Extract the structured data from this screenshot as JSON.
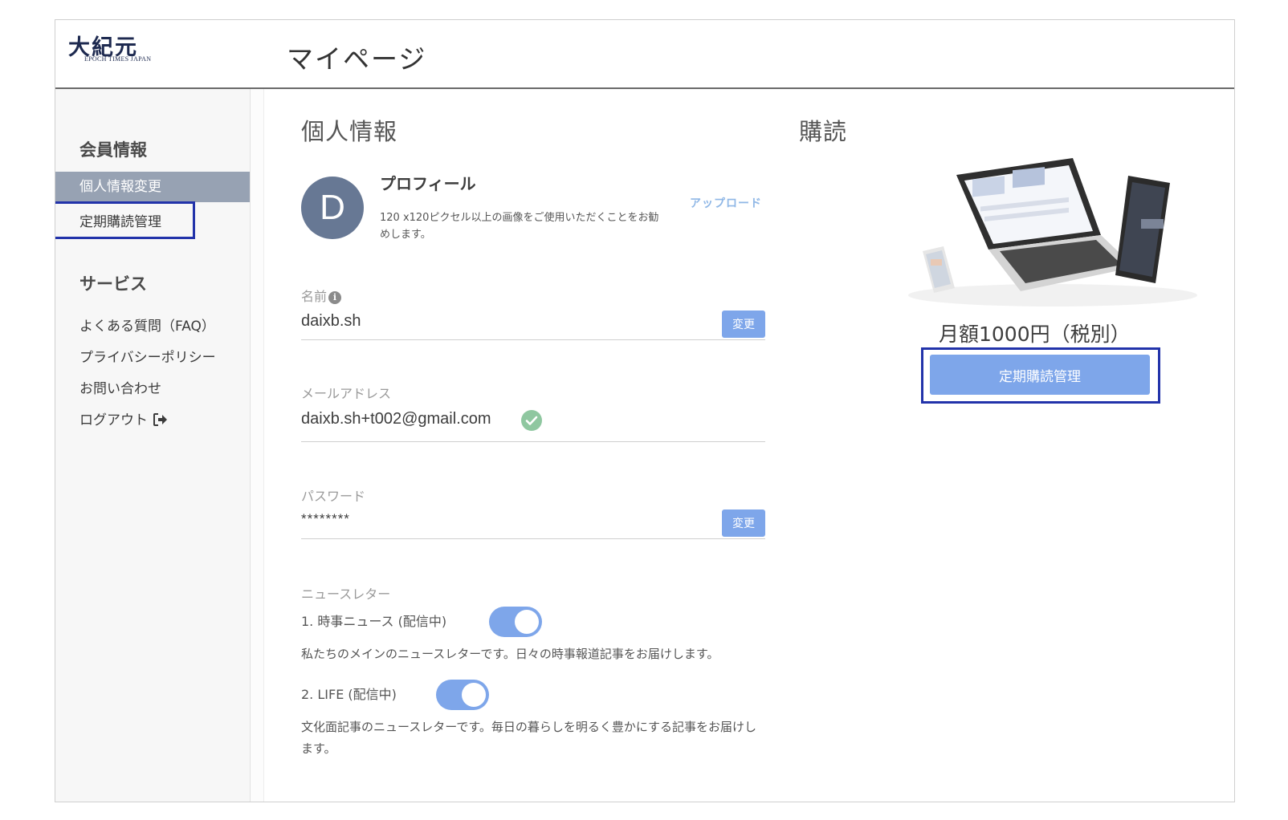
{
  "header": {
    "logo_text": "大紀元",
    "logo_sub": "EPOCH TIMES JAPAN",
    "page_title": "マイページ"
  },
  "sidebar": {
    "member_heading": "会員情報",
    "member_items": [
      "個人情報変更",
      "定期購読管理"
    ],
    "service_heading": "サービス",
    "service_items": [
      "よくある質問（FAQ）",
      "プライバシーポリシー",
      "お問い合わせ",
      "ログアウト"
    ]
  },
  "personal": {
    "title": "個人情報",
    "avatar_letter": "D",
    "profile_title": "プロフィール",
    "profile_desc": "120 x120ピクセル以上の画像をご使用いただくことをお勧めします。",
    "upload_label": "アップロード"
  },
  "fields": {
    "name_label": "名前",
    "name_value": "daixb.sh",
    "email_label": "メールアドレス",
    "email_value": "daixb.sh+t002@gmail.com",
    "password_label": "パスワード",
    "password_value": "********",
    "change_label": "変更"
  },
  "newsletter": {
    "title": "ニュースレター",
    "items": [
      {
        "label": "1. 時事ニュース (配信中)",
        "desc": "私たちのメインのニュースレターです。日々の時事報道記事をお届けします。",
        "enabled": true
      },
      {
        "label": "2. LIFE (配信中)",
        "desc": "文化面記事のニュースレターです。毎日の暮らしを明るく豊かにする記事をお届けします。",
        "enabled": true
      }
    ]
  },
  "subscription": {
    "title": "購読",
    "price": "月額1000円（税別）",
    "manage_button": "定期購読管理"
  },
  "colors": {
    "accent": "#7ea6ea",
    "sidebar_active": "#97a2b3",
    "highlight": "#2233aa",
    "avatar": "#677894",
    "check": "#8fc7a0"
  },
  "icons": {
    "info": "info-icon",
    "verified": "check-circle-icon",
    "logout": "logout-arrow-icon"
  }
}
